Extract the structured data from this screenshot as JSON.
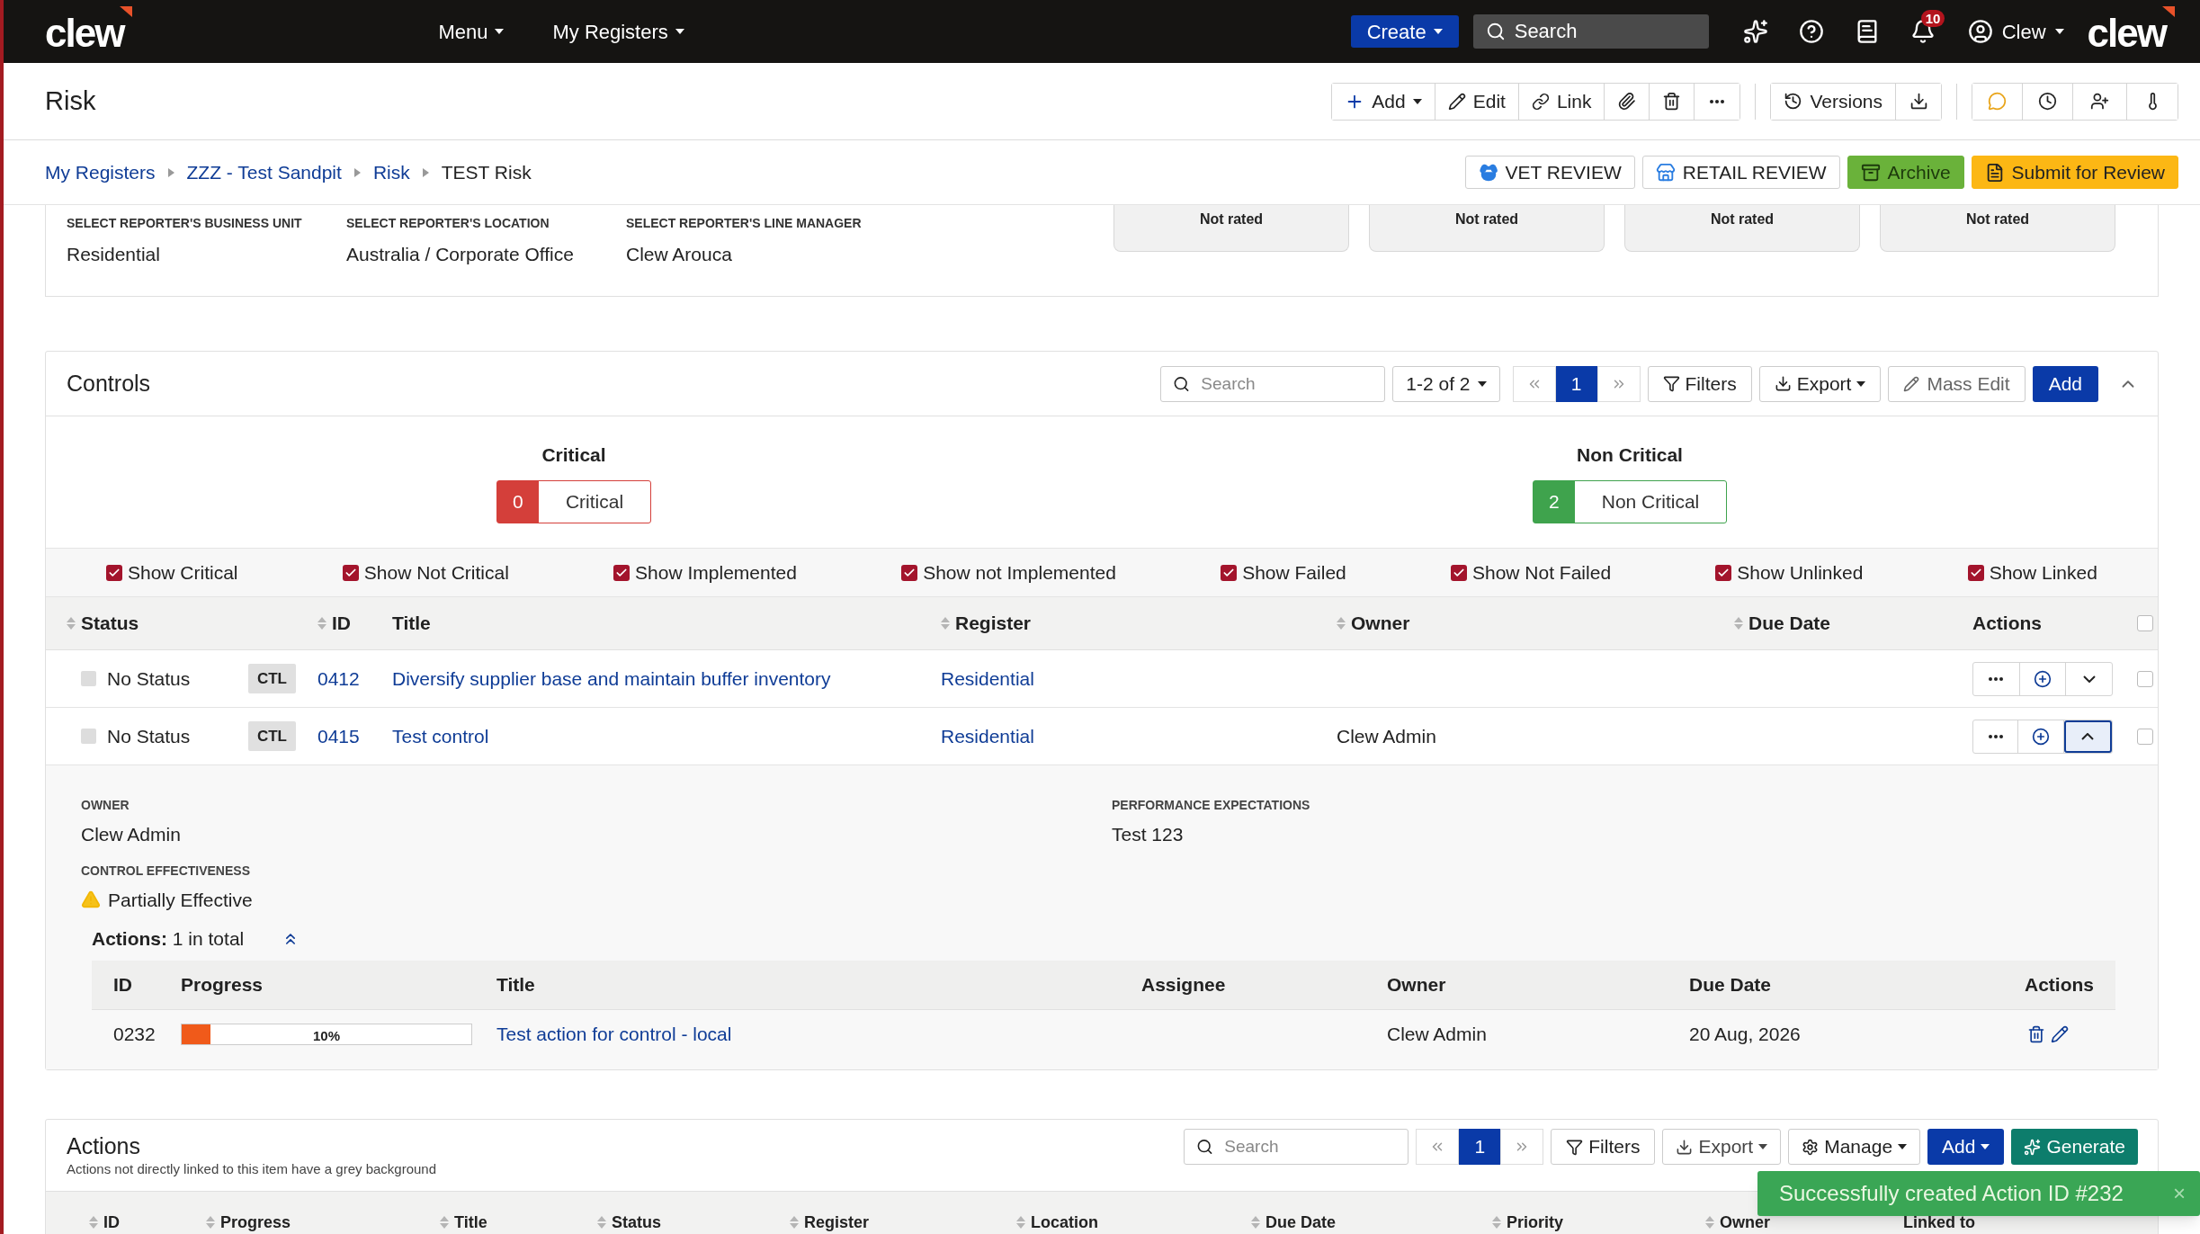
{
  "nav": {
    "logo": "clew",
    "menus": [
      "Menu",
      "My Registers"
    ],
    "create": "Create",
    "search": {
      "placeholder": "Search"
    },
    "notifications": "10",
    "user": "Clew",
    "brand": "clew"
  },
  "header": {
    "title": "Risk",
    "add": "Add",
    "edit": "Edit",
    "link": "Link",
    "versions": "Versions"
  },
  "breadcrumbs": [
    {
      "label": "My Registers",
      "current": false
    },
    {
      "label": "ZZZ - Test Sandpit",
      "current": false
    },
    {
      "label": "Risk",
      "current": false
    },
    {
      "label": "TEST Risk",
      "current": true
    }
  ],
  "review_buttons": [
    {
      "label": "VET REVIEW",
      "kind": "outline"
    },
    {
      "label": "RETAIL REVIEW",
      "kind": "outline"
    },
    {
      "label": "Archive",
      "kind": "green"
    },
    {
      "label": "Submit for Review",
      "kind": "yellow"
    }
  ],
  "details": {
    "fields": [
      {
        "label": "SELECT REPORTER'S BUSINESS UNIT",
        "value": "Residential"
      },
      {
        "label": "SELECT REPORTER'S LOCATION",
        "value": "Australia / Corporate Office"
      },
      {
        "label": "SELECT REPORTER'S LINE MANAGER",
        "value": "Clew Arouca"
      }
    ],
    "ratings": [
      "Not rated",
      "Not rated",
      "Not rated",
      "Not rated"
    ]
  },
  "controls": {
    "title": "Controls",
    "search": {
      "placeholder": "Search"
    },
    "range": "1-2 of 2",
    "page": "1",
    "filters": "Filters",
    "export": "Export",
    "mass_edit": "Mass Edit",
    "add": "Add",
    "summary": [
      {
        "heading": "Critical",
        "count": "0",
        "label": "Critical",
        "color": "#d43f3a"
      },
      {
        "heading": "Non Critical",
        "count": "2",
        "label": "Non Critical",
        "color": "#3fa34d"
      }
    ],
    "toggles": [
      {
        "label": "Show Critical",
        "checked": true
      },
      {
        "label": "Show Not Critical",
        "checked": true
      },
      {
        "label": "Show Implemented",
        "checked": true
      },
      {
        "label": "Show not Implemented",
        "checked": true
      },
      {
        "label": "Show Failed",
        "checked": true
      },
      {
        "label": "Show Not Failed",
        "checked": true
      },
      {
        "label": "Show Unlinked",
        "checked": true
      },
      {
        "label": "Show Linked",
        "checked": true
      }
    ],
    "columns": [
      {
        "label": "Status",
        "sortable": true
      },
      {
        "label": "ID",
        "sortable": true
      },
      {
        "label": "Title",
        "sortable": false
      },
      {
        "label": "Register",
        "sortable": true
      },
      {
        "label": "Owner",
        "sortable": true
      },
      {
        "label": "Due Date",
        "sortable": true
      },
      {
        "label": "Actions",
        "sortable": false
      }
    ],
    "all_selected": false,
    "rows": [
      {
        "status": "No Status",
        "tag": "CTL",
        "id": "0412",
        "title": "Diversify supplier base and maintain buffer inventory",
        "register": "Residential",
        "expanded": false,
        "selected": false
      },
      {
        "status": "No Status",
        "tag": "CTL",
        "id": "0415",
        "title": "Test control",
        "register": "Residential",
        "owner": "Clew Admin",
        "expanded": true,
        "selected": false,
        "detail": {
          "owner_label": "OWNER",
          "owner": "Clew Admin",
          "effectiveness_label": "CONTROL EFFECTIVENESS",
          "effectiveness": "Partially Effective",
          "expectations_label": "PERFORMANCE EXPECTATIONS",
          "expectations": "Test 123",
          "actions_summary": "**Actions:** 1 in total",
          "columns": [
            "ID",
            "Progress",
            "Title",
            "Assignee",
            "Owner",
            "Due Date",
            "Actions"
          ],
          "actions": [
            {
              "id": "0232",
              "level": 0.1,
              "progress": "10%",
              "title": "Test action for control - local",
              "owner": "Clew Admin",
              "due": "20 Aug, 2026"
            }
          ]
        }
      }
    ]
  },
  "actions": {
    "title": "Actions",
    "subtitle": "Actions not directly linked to this item have a grey background",
    "search": {
      "placeholder": "Search"
    },
    "page": "1",
    "filters": "Filters",
    "export": "Export",
    "manage": "Manage",
    "add": "Add",
    "generate": "Generate",
    "columns": [
      {
        "label": "ID",
        "sortable": true
      },
      {
        "label": "Progress",
        "sortable": true
      },
      {
        "label": "Title",
        "sortable": true
      },
      {
        "label": "Status",
        "sortable": true
      },
      {
        "label": "Register",
        "sortable": true
      },
      {
        "label": "Location",
        "sortable": true
      },
      {
        "label": "Due Date",
        "sortable": true
      },
      {
        "label": "Priority",
        "sortable": true
      },
      {
        "label": "Owner",
        "sortable": true
      },
      {
        "label": "Linked to",
        "sortable": false
      }
    ]
  },
  "toast": {
    "message": "Successfully created Action ID #232",
    "close": "×"
  }
}
